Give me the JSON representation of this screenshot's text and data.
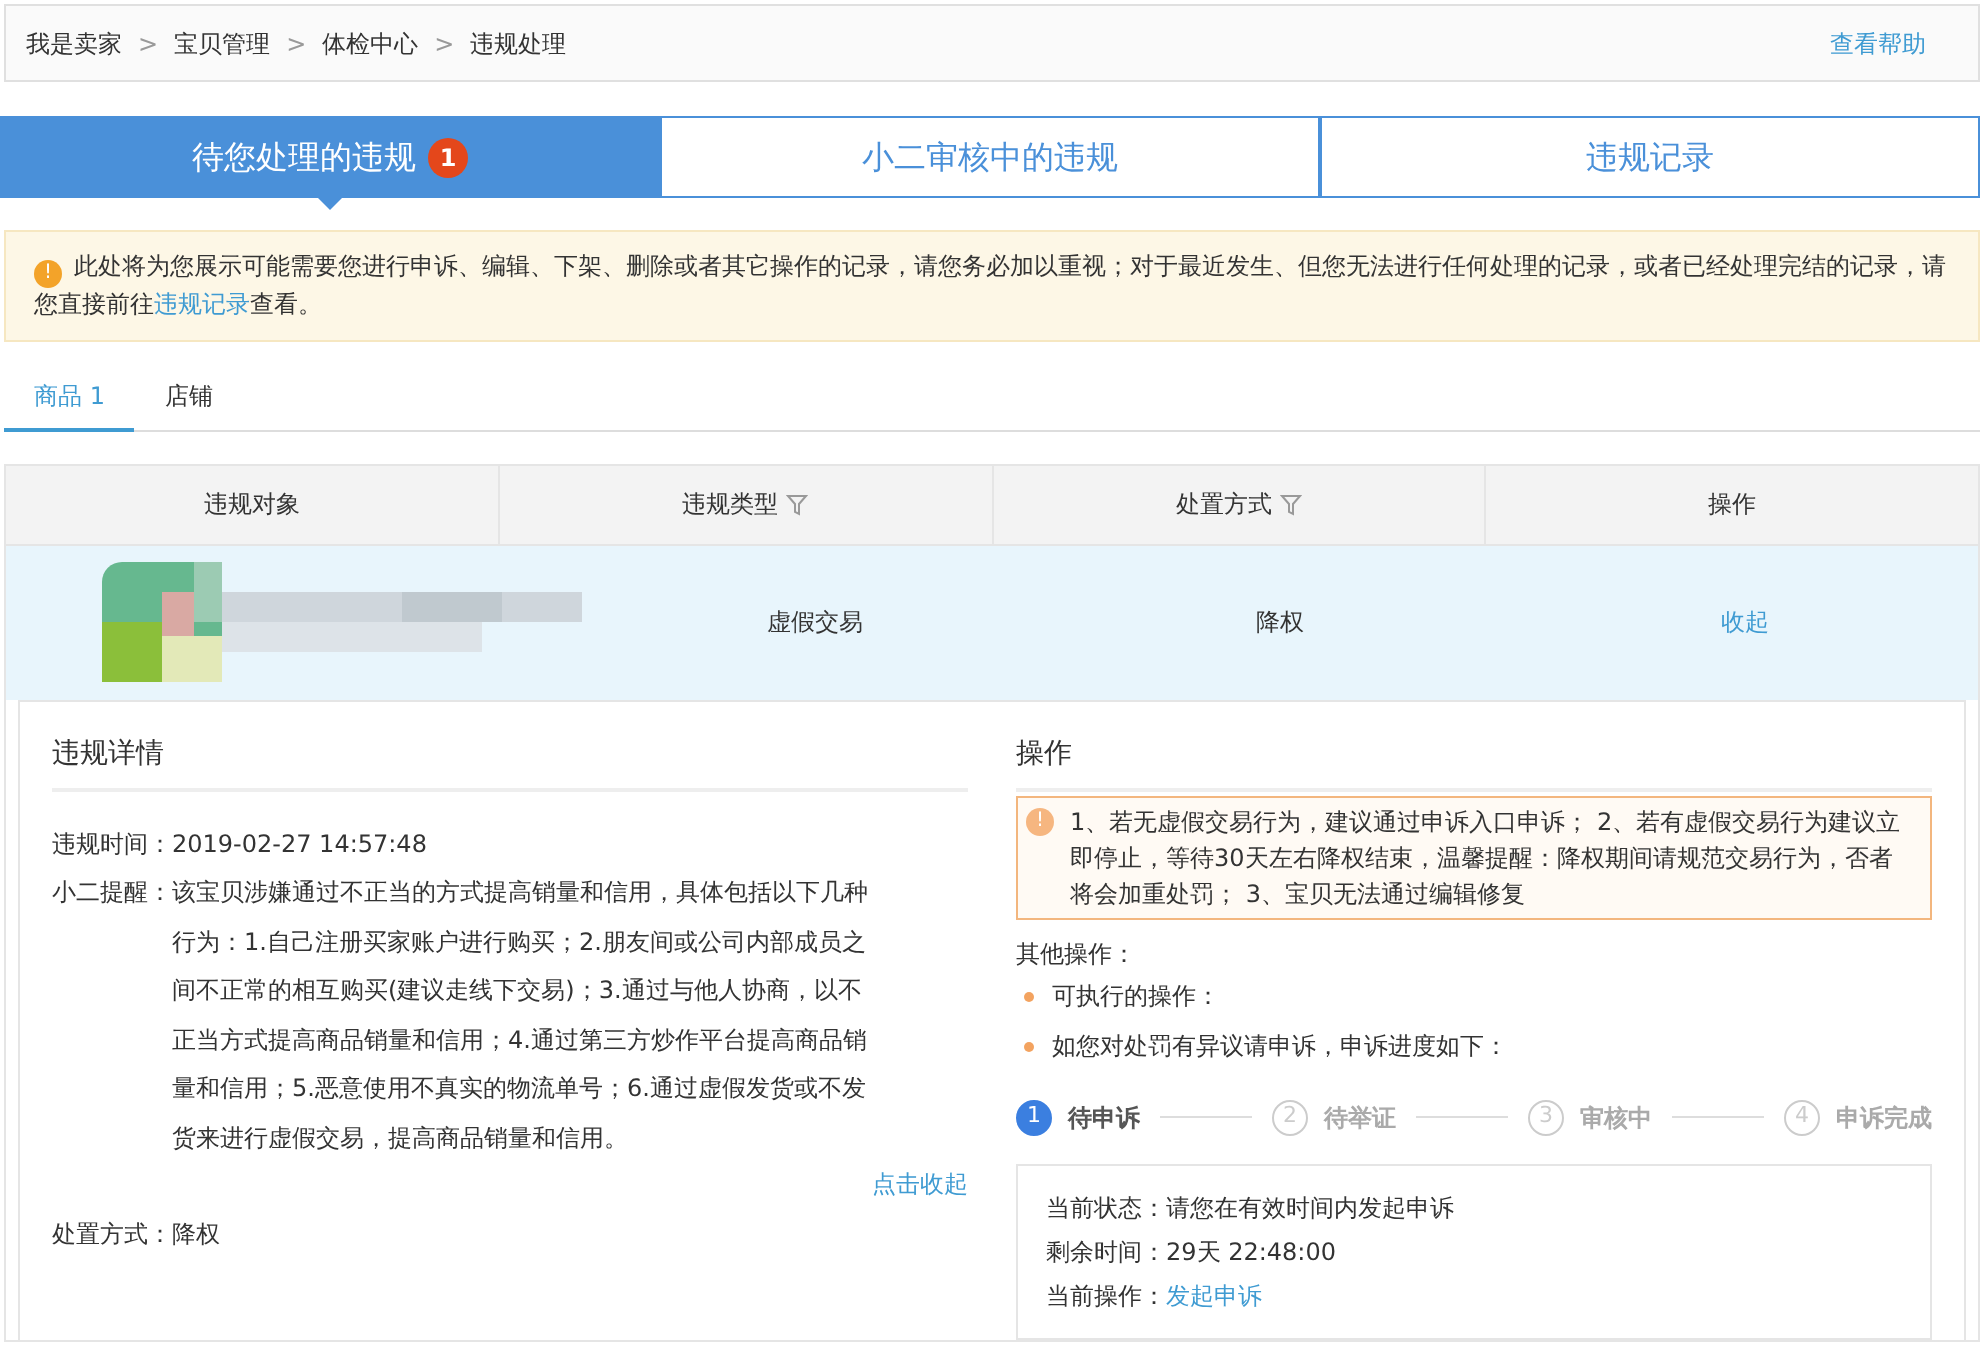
{
  "breadcrumb": {
    "items": [
      "我是卖家",
      "宝贝管理",
      "体检中心",
      "违规处理"
    ],
    "separator": ">",
    "help_link": "查看帮助"
  },
  "tabs": [
    {
      "label": "待您处理的违规",
      "badge": "1",
      "selected": true
    },
    {
      "label": "小二审核中的违规",
      "selected": false
    },
    {
      "label": "违规记录",
      "selected": false
    }
  ],
  "notice": {
    "icon": "!",
    "before": "此处将为您展示可能需要您进行申诉、编辑、下架、删除或者其它操作的记录，请您务必加以重视；对于最近发生、但您无法进行任何处理的记录，或者已经处理完结的记录，请您直接前往",
    "link": "违规记录",
    "after": "查看。"
  },
  "subtabs": [
    {
      "label": "商品 1",
      "selected": true
    },
    {
      "label": "店铺",
      "selected": false
    }
  ],
  "table": {
    "columns": [
      {
        "label": "违规对象",
        "filter": false
      },
      {
        "label": "违规类型",
        "filter": true
      },
      {
        "label": "处置方式",
        "filter": true
      },
      {
        "label": "操作",
        "filter": false
      }
    ],
    "rows": [
      {
        "type": "虚假交易",
        "disposition": "降权",
        "action": "收起"
      }
    ]
  },
  "details": {
    "title": "违规详情",
    "fields": [
      {
        "label": "违规时间：",
        "value": "2019-02-27 14:57:48"
      },
      {
        "label": "小二提醒：",
        "value": "该宝贝涉嫌通过不正当的方式提高销量和信用，具体包括以下几种行为：1.自己注册买家账户进行购买；2.朋友间或公司内部成员之间不正常的相互购买(建议走线下交易)；3.通过与他人协商，以不正当方式提高商品销量和信用；4.通过第三方炒作平台提高商品销量和信用；5.恶意使用不真实的物流单号；6.通过虚假发货或不发货来进行虚假交易，提高商品销量和信用。"
      }
    ],
    "collapse_link": "点击收起",
    "disposition": {
      "label": "处置方式：",
      "value": "降权"
    }
  },
  "operations": {
    "title": "操作",
    "warning": {
      "icon": "!",
      "text": "1、若无虚假交易行为，建议通过申诉入口申诉； 2、若有虚假交易行为建议立即停止，等待30天左右降权结束，温馨提醒：降权期间请规范交易行为，否者将会加重处罚； 3、宝贝无法通过编辑修复"
    },
    "other_title": "其他操作：",
    "bullets": [
      "可执行的操作：",
      "如您对处罚有异议请申诉，申诉进度如下："
    ],
    "steps": [
      {
        "number": "1",
        "label": "待申诉",
        "selected": true
      },
      {
        "number": "2",
        "label": "待举证",
        "selected": false
      },
      {
        "number": "3",
        "label": "审核中",
        "selected": false
      },
      {
        "number": "4",
        "label": "申诉完成",
        "selected": false
      }
    ],
    "status": [
      {
        "label": "当前状态：",
        "value": "请您在有效时间内发起申诉",
        "kind": "text"
      },
      {
        "label": "剩余时间：",
        "value": "29天 22:48:00",
        "kind": "text"
      },
      {
        "label": "当前操作：",
        "value": "发起申诉",
        "kind": "link"
      }
    ]
  }
}
